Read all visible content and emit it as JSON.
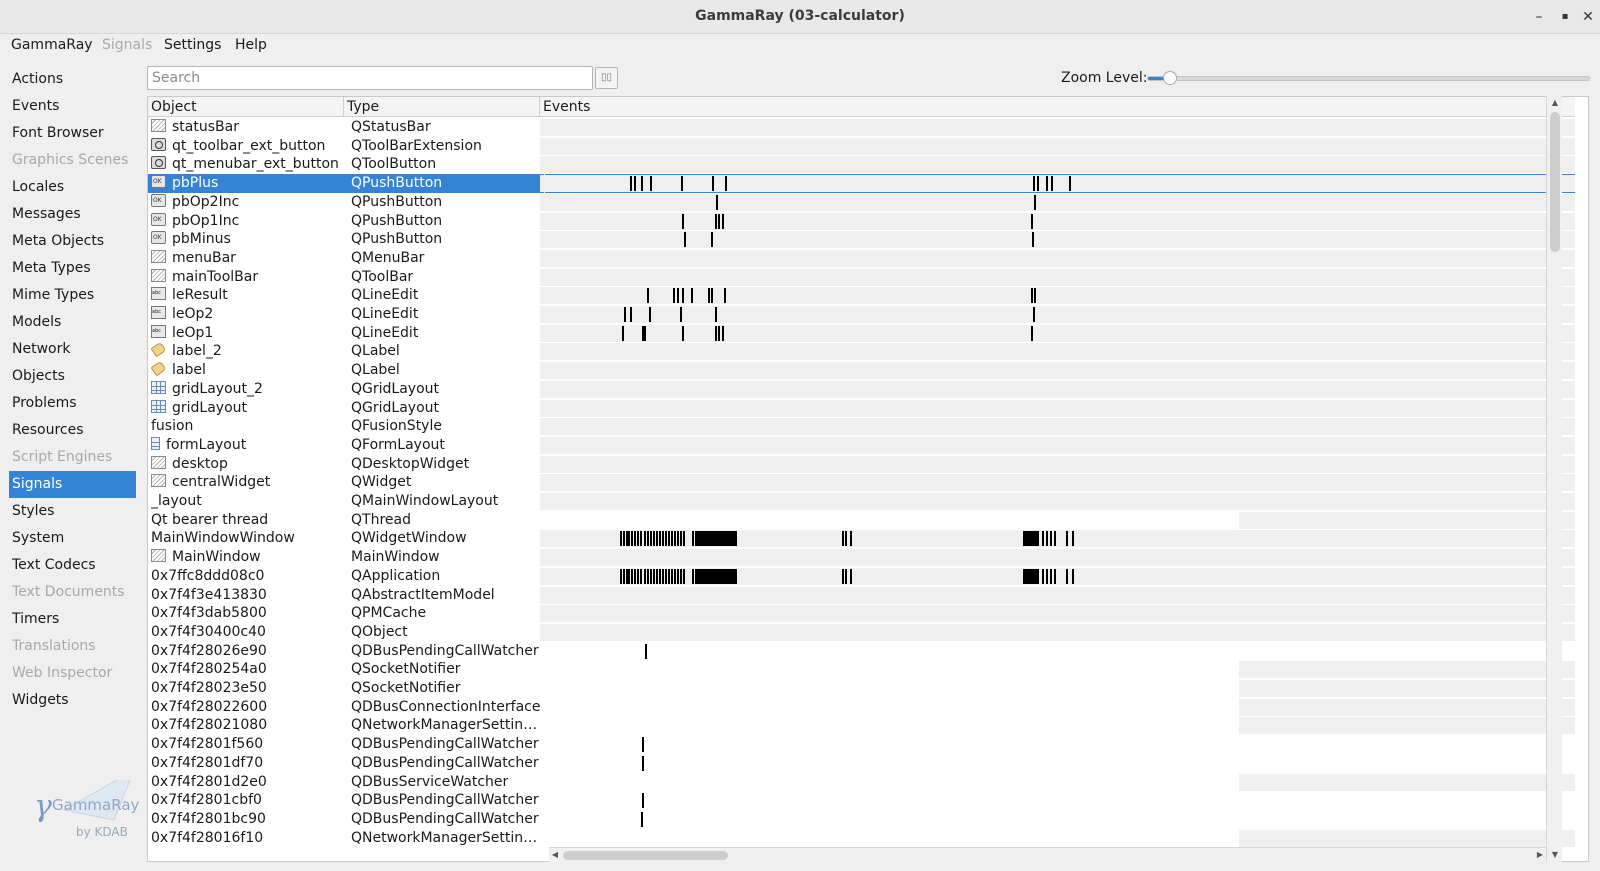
{
  "window": {
    "title": "GammaRay (03-calculator)",
    "buttons": [
      "–",
      "▪",
      "✕"
    ]
  },
  "menubar": [
    {
      "label": "GammaRay",
      "disabled": false
    },
    {
      "label": "Signals",
      "disabled": true
    },
    {
      "label": "Settings",
      "disabled": false
    },
    {
      "label": "Help",
      "disabled": false
    }
  ],
  "sidebar": {
    "items": [
      {
        "label": "Actions",
        "disabled": false
      },
      {
        "label": "Events",
        "disabled": false
      },
      {
        "label": "Font Browser",
        "disabled": false
      },
      {
        "label": "Graphics Scenes",
        "disabled": true
      },
      {
        "label": "Locales",
        "disabled": false
      },
      {
        "label": "Messages",
        "disabled": false
      },
      {
        "label": "Meta Objects",
        "disabled": false
      },
      {
        "label": "Meta Types",
        "disabled": false
      },
      {
        "label": "Mime Types",
        "disabled": false
      },
      {
        "label": "Models",
        "disabled": false
      },
      {
        "label": "Network",
        "disabled": false
      },
      {
        "label": "Objects",
        "disabled": false
      },
      {
        "label": "Problems",
        "disabled": false
      },
      {
        "label": "Resources",
        "disabled": false
      },
      {
        "label": "Script Engines",
        "disabled": true
      },
      {
        "label": "Signals",
        "disabled": false,
        "selected": true
      },
      {
        "label": "Styles",
        "disabled": false
      },
      {
        "label": "System",
        "disabled": false
      },
      {
        "label": "Text Codecs",
        "disabled": false
      },
      {
        "label": "Text Documents",
        "disabled": true
      },
      {
        "label": "Timers",
        "disabled": false
      },
      {
        "label": "Translations",
        "disabled": true
      },
      {
        "label": "Web Inspector",
        "disabled": true
      },
      {
        "label": "Widgets",
        "disabled": false
      }
    ]
  },
  "logo": {
    "text": "GammaRay",
    "byline": "by KDAB",
    "symbol": "γ"
  },
  "search": {
    "placeholder": "Search",
    "value": "",
    "button_icon": "filter-icon"
  },
  "zoom": {
    "label": "Zoom Level:",
    "level": 0.05
  },
  "table": {
    "headers": [
      "Object",
      "Type",
      "Events"
    ],
    "rows": [
      {
        "object": "statusBar",
        "type": "QStatusBar",
        "icon": "widget",
        "ev": "full",
        "marks": []
      },
      {
        "object": "qt_toolbar_ext_button",
        "type": "QToolBarExtension",
        "icon": "toolbtn",
        "ev": "full",
        "marks": []
      },
      {
        "object": "qt_menubar_ext_button",
        "type": "QToolButton",
        "icon": "toolbtn",
        "ev": "full",
        "marks": []
      },
      {
        "object": "pbPlus",
        "type": "QPushButton",
        "icon": "button",
        "ev": "full",
        "selected": true,
        "marks": [
          90,
          94,
          101,
          110,
          141,
          172,
          185,
          493,
          497,
          506,
          511,
          529
        ]
      },
      {
        "object": "pbOp2Inc",
        "type": "QPushButton",
        "icon": "button",
        "ev": "full",
        "marks": [
          176,
          494
        ]
      },
      {
        "object": "pbOp1Inc",
        "type": "QPushButton",
        "icon": "button",
        "ev": "full",
        "marks": [
          142,
          175,
          178,
          182,
          491
        ]
      },
      {
        "object": "pbMinus",
        "type": "QPushButton",
        "icon": "button",
        "ev": "full",
        "marks": [
          144,
          171,
          492
        ]
      },
      {
        "object": "menuBar",
        "type": "QMenuBar",
        "icon": "widget",
        "ev": "full",
        "marks": []
      },
      {
        "object": "mainToolBar",
        "type": "QToolBar",
        "icon": "widget",
        "ev": "full",
        "marks": []
      },
      {
        "object": "leResult",
        "type": "QLineEdit",
        "icon": "lineedit",
        "ev": "full",
        "marks": [
          107,
          133,
          137,
          142,
          151,
          168,
          171,
          184,
          491,
          494
        ]
      },
      {
        "object": "leOp2",
        "type": "QLineEdit",
        "icon": "lineedit",
        "ev": "full",
        "marks": [
          84,
          90,
          109,
          140,
          175,
          493
        ]
      },
      {
        "object": "leOp1",
        "type": "QLineEdit",
        "icon": "lineedit",
        "ev": "full",
        "marks": [
          82,
          102,
          104,
          142,
          175,
          178,
          182,
          491
        ]
      },
      {
        "object": "label_2",
        "type": "QLabel",
        "icon": "label",
        "ev": "full",
        "marks": []
      },
      {
        "object": "label",
        "type": "QLabel",
        "icon": "label",
        "ev": "full",
        "marks": []
      },
      {
        "object": "gridLayout_2",
        "type": "QGridLayout",
        "icon": "grid",
        "ev": "full",
        "marks": []
      },
      {
        "object": "gridLayout",
        "type": "QGridLayout",
        "icon": "grid",
        "ev": "full",
        "marks": []
      },
      {
        "object": "fusion",
        "type": "QFusionStyle",
        "icon": "",
        "ev": "full",
        "marks": []
      },
      {
        "object": "formLayout",
        "type": "QFormLayout",
        "icon": "form",
        "ev": "full",
        "marks": []
      },
      {
        "object": "desktop",
        "type": "QDesktopWidget",
        "icon": "widget",
        "ev": "full",
        "marks": []
      },
      {
        "object": "centralWidget",
        "type": "QWidget",
        "icon": "widget",
        "ev": "full",
        "marks": []
      },
      {
        "object": "_layout",
        "type": "QMainWindowLayout",
        "icon": "",
        "ev": "full",
        "marks": []
      },
      {
        "object": "Qt bearer thread",
        "type": "QThread",
        "icon": "",
        "ev": "partial",
        "marks": []
      },
      {
        "object": "MainWindowWindow",
        "type": "QWidgetWindow",
        "icon": "",
        "ev": "full",
        "marks": [
          80,
          83,
          86,
          88,
          91,
          94,
          97,
          100,
          104,
          107,
          110,
          113,
          116,
          119,
          122,
          125,
          128,
          131,
          134,
          137,
          140,
          143,
          152,
          155,
          157,
          159,
          161,
          163,
          165,
          167,
          169,
          171,
          173,
          175,
          177,
          179,
          181,
          183,
          185,
          187,
          189,
          191,
          193,
          195,
          302,
          305,
          310,
          483,
          485,
          487,
          489,
          491,
          493,
          495,
          497,
          502,
          506,
          510,
          514,
          526,
          532
        ]
      },
      {
        "object": "MainWindow",
        "type": "MainWindow",
        "icon": "widget",
        "ev": "full",
        "marks": []
      },
      {
        "object": "0x7ffc8ddd08c0",
        "type": "QApplication",
        "icon": "",
        "ev": "full",
        "marks": [
          80,
          83,
          86,
          88,
          91,
          94,
          97,
          100,
          104,
          107,
          110,
          113,
          116,
          119,
          122,
          125,
          128,
          131,
          134,
          137,
          140,
          143,
          152,
          155,
          157,
          159,
          161,
          163,
          165,
          167,
          169,
          171,
          173,
          175,
          177,
          179,
          181,
          183,
          185,
          187,
          189,
          191,
          193,
          195,
          302,
          305,
          310,
          483,
          485,
          487,
          489,
          491,
          493,
          495,
          497,
          502,
          506,
          510,
          514,
          526,
          532
        ]
      },
      {
        "object": "0x7f4f3e413830",
        "type": "QAbstractItemModel",
        "icon": "",
        "ev": "full",
        "marks": []
      },
      {
        "object": "0x7f4f3dab5800",
        "type": "QPMCache",
        "icon": "",
        "ev": "full",
        "marks": []
      },
      {
        "object": "0x7f4f30400c40",
        "type": "QObject",
        "icon": "",
        "ev": "full",
        "marks": []
      },
      {
        "object": "0x7f4f28026e90",
        "type": "QDBusPendingCallWatcher",
        "icon": "",
        "ev": "none",
        "marks": [
          105
        ]
      },
      {
        "object": "0x7f4f280254a0",
        "type": "QSocketNotifier",
        "icon": "",
        "ev": "partial",
        "marks": []
      },
      {
        "object": "0x7f4f28023e50",
        "type": "QSocketNotifier",
        "icon": "",
        "ev": "partial",
        "marks": []
      },
      {
        "object": "0x7f4f28022600",
        "type": "QDBusConnectionInterface",
        "icon": "",
        "ev": "partial",
        "marks": []
      },
      {
        "object": "0x7f4f28021080",
        "type": "QNetworkManagerSettin…",
        "icon": "",
        "ev": "partial",
        "marks": []
      },
      {
        "object": "0x7f4f2801f560",
        "type": "QDBusPendingCallWatcher",
        "icon": "",
        "ev": "none",
        "marks": [
          102
        ]
      },
      {
        "object": "0x7f4f2801df70",
        "type": "QDBusPendingCallWatcher",
        "icon": "",
        "ev": "none",
        "marks": [
          102
        ]
      },
      {
        "object": "0x7f4f2801d2e0",
        "type": "QDBusServiceWatcher",
        "icon": "",
        "ev": "partial",
        "marks": []
      },
      {
        "object": "0x7f4f2801cbf0",
        "type": "QDBusPendingCallWatcher",
        "icon": "",
        "ev": "none",
        "marks": [
          102
        ]
      },
      {
        "object": "0x7f4f2801bc90",
        "type": "QDBusPendingCallWatcher",
        "icon": "",
        "ev": "none",
        "marks": [
          101
        ]
      },
      {
        "object": "0x7f4f28016f10",
        "type": "QNetworkManagerSettin…",
        "icon": "",
        "ev": "partial",
        "marks": []
      }
    ]
  },
  "scrollbars": {
    "vertical_position": 0.0,
    "horizontal_position": 0.0
  },
  "colors": {
    "accent": "#3584d4",
    "event_mark": "#000000",
    "event_row_bg": "#efefef"
  }
}
